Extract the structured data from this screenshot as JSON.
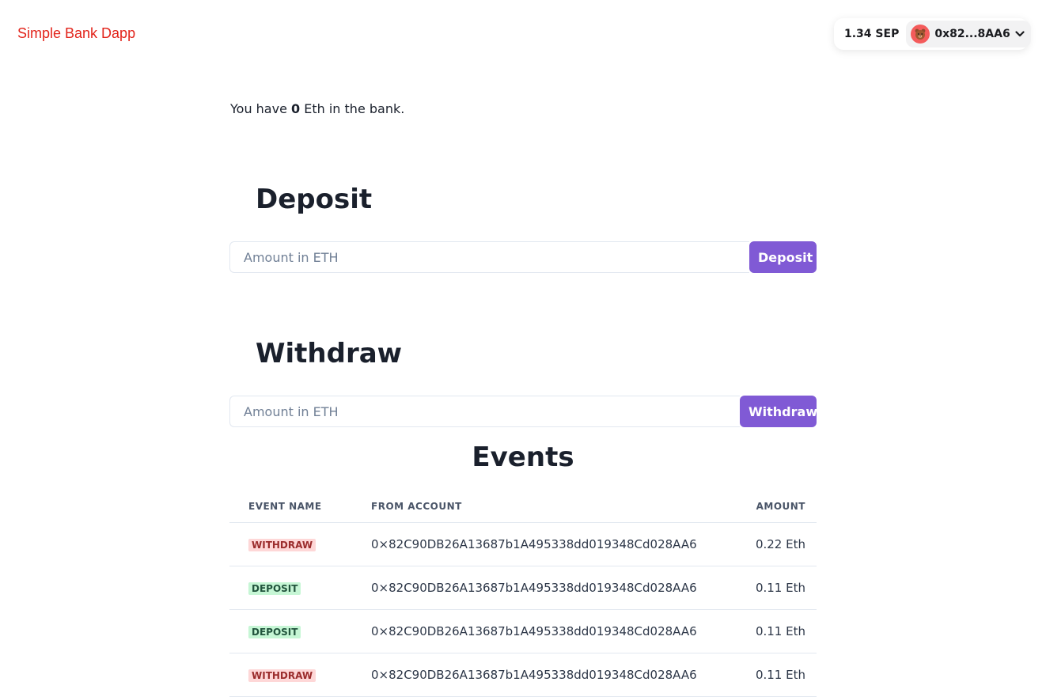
{
  "app": {
    "title": "Simple Bank Dapp"
  },
  "wallet": {
    "balance": "1.34 SEP",
    "address": "0x82...8AA6",
    "avatar_icon": "bear-emoji-icon",
    "avatar_color": "#f45b5b"
  },
  "balance": {
    "prefix": "You have ",
    "amount": "0",
    "suffix": " Eth in the bank."
  },
  "deposit": {
    "heading": "Deposit",
    "placeholder": "Amount in ETH",
    "value": "",
    "button_label": "Deposit"
  },
  "withdraw": {
    "heading": "Withdraw",
    "placeholder": "Amount in ETH",
    "value": "",
    "button_label": "Withdraw"
  },
  "events": {
    "heading": "Events",
    "columns": [
      "EVENT NAME",
      "FROM ACCOUNT",
      "AMOUNT"
    ],
    "rows": [
      {
        "event": "WITHDRAW",
        "type": "withdraw",
        "from": "0×82C90DB26A13687b1A495338dd019348Cd028AA6",
        "amount": "0.22 Eth"
      },
      {
        "event": "DEPOSIT",
        "type": "deposit",
        "from": "0×82C90DB26A13687b1A495338dd019348Cd028AA6",
        "amount": "0.11 Eth"
      },
      {
        "event": "DEPOSIT",
        "type": "deposit",
        "from": "0×82C90DB26A13687b1A495338dd019348Cd028AA6",
        "amount": "0.11 Eth"
      },
      {
        "event": "WITHDRAW",
        "type": "withdraw",
        "from": "0×82C90DB26A13687b1A495338dd019348Cd028AA6",
        "amount": "0.11 Eth"
      }
    ]
  },
  "colors": {
    "brand_title": "#e2231a",
    "accent_button": "#805ad5",
    "withdraw_badge_bg": "#fed7d7",
    "withdraw_badge_text": "#9b2c2c",
    "deposit_badge_bg": "#c6f6d5",
    "deposit_badge_text": "#22543d"
  }
}
